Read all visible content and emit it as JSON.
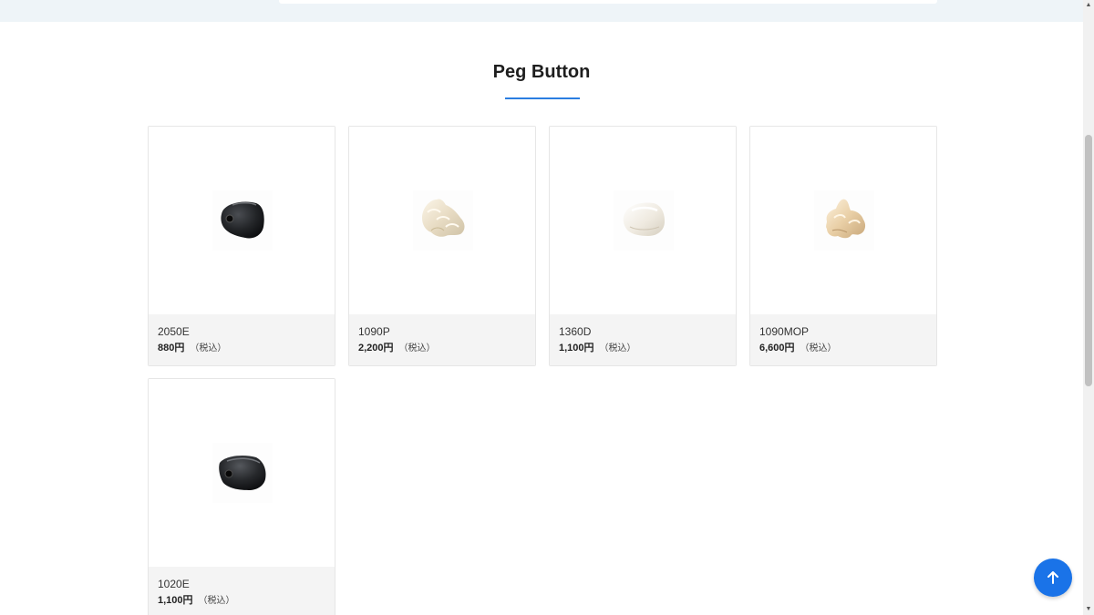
{
  "section": {
    "title": "Peg Button"
  },
  "products": [
    {
      "code": "2050E",
      "price": "880円",
      "tax": "（税込）",
      "icon": "black-peg-button-icon"
    },
    {
      "code": "1090P",
      "price": "2,200円",
      "tax": "（税込）",
      "icon": "pearl-peg-button-icon"
    },
    {
      "code": "1360D",
      "price": "1,100円",
      "tax": "（税込）",
      "icon": "white-peg-button-icon"
    },
    {
      "code": "1090MOP",
      "price": "6,600円",
      "tax": "（税込）",
      "icon": "mop-peg-button-icon"
    },
    {
      "code": "1020E",
      "price": "1,100円",
      "tax": "（税込）",
      "icon": "black-peg-button-icon"
    }
  ],
  "back_to_top": {
    "icon": "arrow-up-icon"
  },
  "colors": {
    "accent": "#2a7de1",
    "button": "#1a73e8",
    "card_info_bg": "#f4f4f4"
  }
}
